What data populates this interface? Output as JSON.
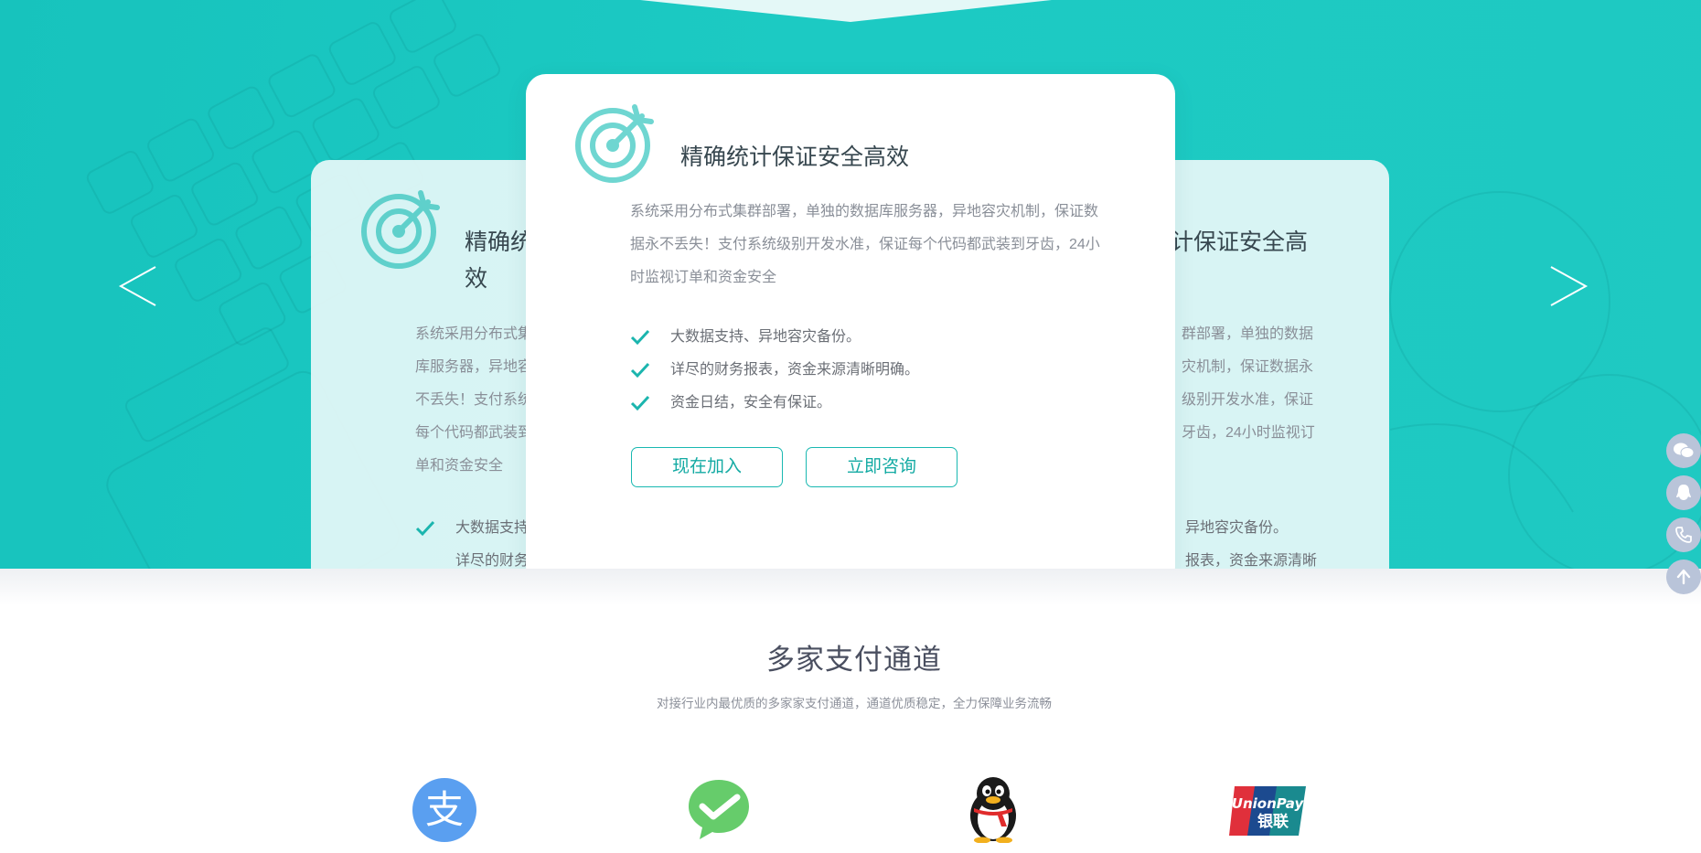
{
  "hero": {
    "arrows": {
      "prev": "‹",
      "next": "›"
    },
    "card_main": {
      "title": "精确统计保证安全高效",
      "desc_lines": [
        "系统采用分布式集群部署，单独的数据库服务器，异地容灾机制，保证数",
        "据永不丢失！支付系统级别开发水准，保证每个代码都武装到牙齿，24小",
        "时监视订单和资金安全"
      ],
      "features": [
        "大数据支持、异地容灾备份。",
        "详尽的财务报表，资金来源清晰明确。",
        "资金日结，安全有保证。"
      ],
      "join_button": "现在加入",
      "consult_button": "立即咨询"
    },
    "card_left": {
      "title_lines": [
        "精确统",
        "效"
      ],
      "desc_lines": [
        "系统采用分布式集",
        "库服务器，异地容",
        "不丢失！支付系统",
        "每个代码都武装到",
        "单和资金安全"
      ],
      "features": [
        "大数据支持",
        "详尽的财务"
      ]
    },
    "card_right": {
      "title_line": "计保证安全高",
      "desc_lines": [
        "群部署，单独的数据",
        "灾机制，保证数据永",
        "级别开发水准，保证",
        "牙齿，24小时监视订"
      ],
      "features": [
        "异地容灾备份。",
        "报表，资金来源清晰"
      ]
    },
    "accent_color": "#1ccac3"
  },
  "floating_contacts": [
    {
      "icon": "wechat-icon"
    },
    {
      "icon": "qq-icon"
    },
    {
      "icon": "phone-icon"
    },
    {
      "icon": "back-to-top-icon"
    }
  ],
  "payment": {
    "title": "多家支付通道",
    "subtitle": "对接行业内最优质的多家家支付通道，通道优质稳定，全力保障业务流畅",
    "logos": [
      {
        "name": "alipay-logo",
        "glyph": "支",
        "color": "#5a9ff0"
      },
      {
        "name": "wechat-pay-logo",
        "color": "#66cc6b"
      },
      {
        "name": "qq-pay-logo"
      },
      {
        "name": "unionpay-logo",
        "text_top": "UnionPay",
        "text_bottom": "银联"
      }
    ]
  }
}
